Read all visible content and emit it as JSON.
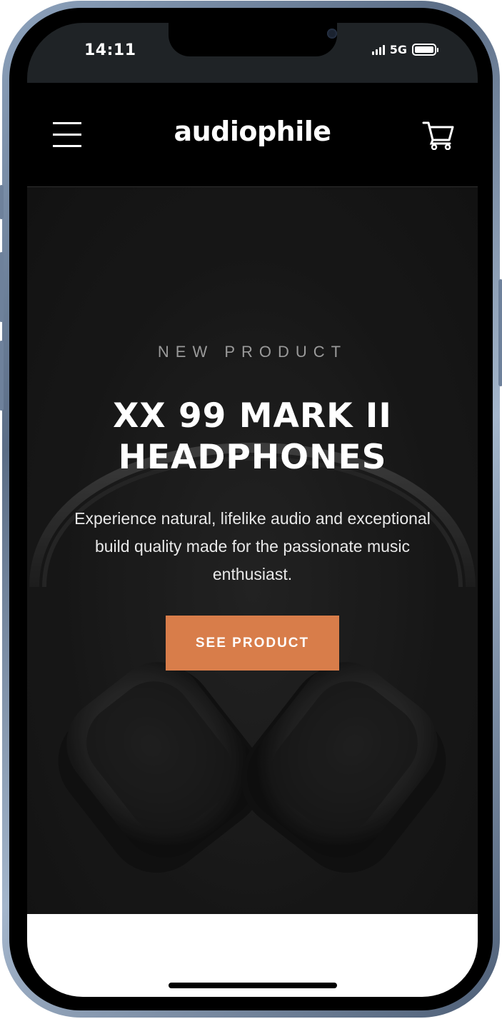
{
  "status_bar": {
    "time": "14:11",
    "network": "5G",
    "icons": [
      "cellular-signal-icon",
      "battery-icon"
    ]
  },
  "header": {
    "logo": "audiophile",
    "icons": [
      "hamburger-menu-icon",
      "shopping-cart-icon"
    ]
  },
  "hero": {
    "eyebrow": "NEW PRODUCT",
    "title": "XX 99 MARK II HEADPHONES",
    "description": "Experience natural, lifelike audio and exceptional build quality made for the passionate music enthusiast.",
    "cta_label": "SEE PRODUCT",
    "image": "headphones-photo"
  },
  "colors": {
    "accent": "#D87D4A",
    "header_bg": "#000000",
    "hero_bg": "#191919",
    "status_bar_bg": "#1F2326"
  }
}
